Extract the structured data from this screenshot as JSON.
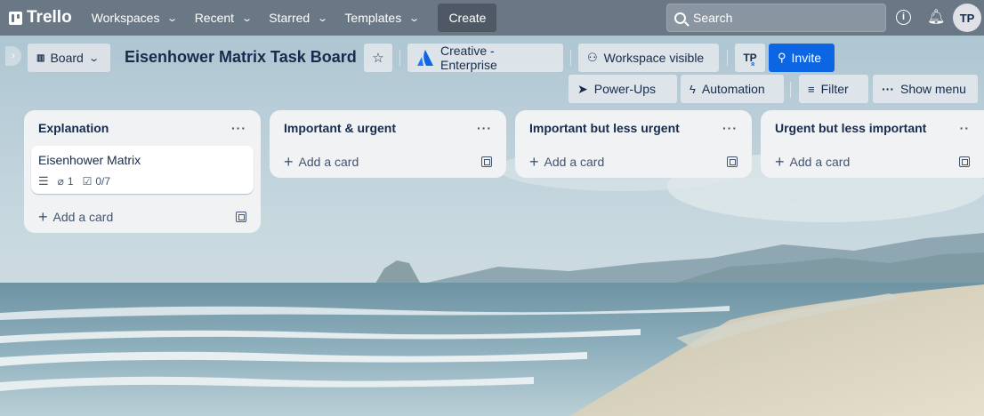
{
  "topbar": {
    "logo": "Trello",
    "workspaces": "Workspaces",
    "recent": "Recent",
    "starred": "Starred",
    "templates": "Templates",
    "create": "Create",
    "search_placeholder": "Search",
    "avatar": "TP"
  },
  "board_header": {
    "view": "Board",
    "title": "Eisenhower Matrix Task Board",
    "workspace": "Creative - Enterprise",
    "visibility": "Workspace visible",
    "member": "TP",
    "invite": "Invite",
    "power_ups": "Power-Ups",
    "automation": "Automation",
    "filter": "Filter",
    "show_menu": "Show menu"
  },
  "lists": [
    {
      "title": "Explanation",
      "cards": [
        {
          "title": "Eisenhower Matrix",
          "attachments": "1",
          "checklist": "0/7"
        }
      ],
      "add_card": "Add a card"
    },
    {
      "title": "Important & urgent",
      "cards": [],
      "add_card": "Add a card"
    },
    {
      "title": "Important but less urgent",
      "cards": [],
      "add_card": "Add a card"
    },
    {
      "title": "Urgent but less important",
      "cards": [],
      "add_card": "Add a card"
    }
  ],
  "colors": {
    "topbar": "#6a7785",
    "invite": "#0c66e4",
    "list_bg": "#f1f2f4"
  }
}
